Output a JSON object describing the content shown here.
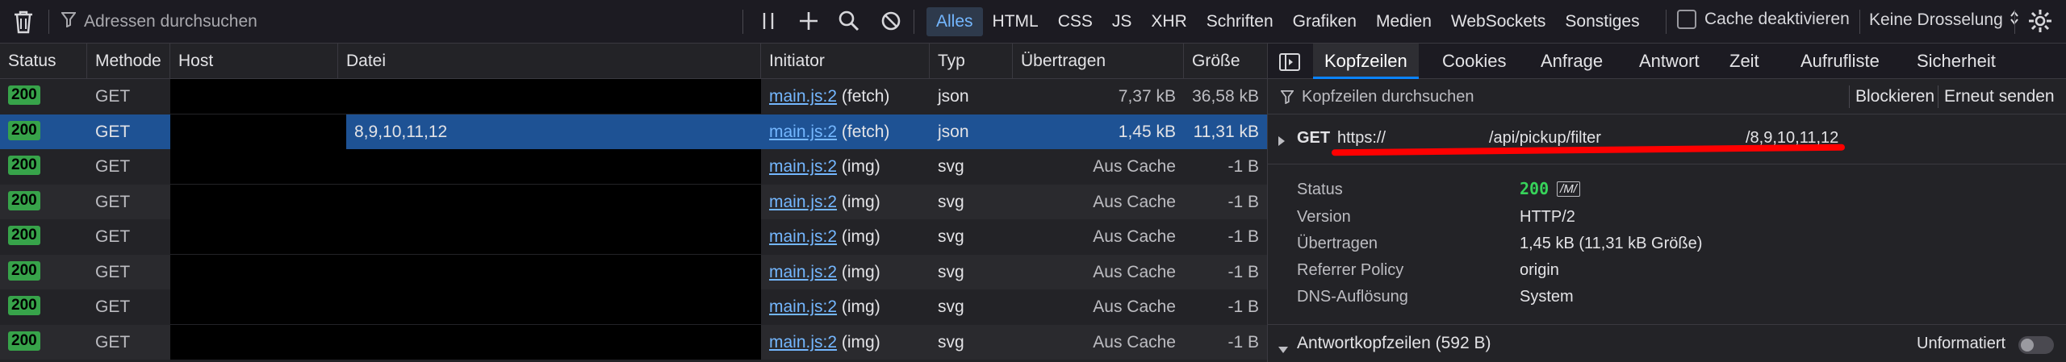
{
  "toolbar": {
    "filter_placeholder": "Adressen durchsuchen",
    "type_filters": [
      "Alles",
      "HTML",
      "CSS",
      "JS",
      "XHR",
      "Schriften",
      "Grafiken",
      "Medien",
      "WebSockets",
      "Sonstiges"
    ],
    "active_type": "Alles",
    "cache_label": "Cache deaktivieren",
    "throttle_label": "Keine Drosselung"
  },
  "table": {
    "headers": [
      "Status",
      "Methode",
      "Host",
      "Datei",
      "Initiator",
      "Typ",
      "Übertragen",
      "Größe"
    ],
    "rows": [
      {
        "status": "200",
        "method": "GET",
        "file": "",
        "initiator_link": "main.js:2",
        "initiator_kind": "(fetch)",
        "type": "json",
        "transferred": "7,37 kB",
        "size": "36,58 kB"
      },
      {
        "status": "200",
        "method": "GET",
        "file": "8,9,10,11,12",
        "initiator_link": "main.js:2",
        "initiator_kind": "(fetch)",
        "type": "json",
        "transferred": "1,45 kB",
        "size": "11,31 kB"
      },
      {
        "status": "200",
        "method": "GET",
        "file": "",
        "initiator_link": "main.js:2",
        "initiator_kind": "(img)",
        "type": "svg",
        "transferred": "Aus Cache",
        "size": "-1 B"
      },
      {
        "status": "200",
        "method": "GET",
        "file": "",
        "initiator_link": "main.js:2",
        "initiator_kind": "(img)",
        "type": "svg",
        "transferred": "Aus Cache",
        "size": "-1 B"
      },
      {
        "status": "200",
        "method": "GET",
        "file": "",
        "initiator_link": "main.js:2",
        "initiator_kind": "(img)",
        "type": "svg",
        "transferred": "Aus Cache",
        "size": "-1 B"
      },
      {
        "status": "200",
        "method": "GET",
        "file": "",
        "initiator_link": "main.js:2",
        "initiator_kind": "(img)",
        "type": "svg",
        "transferred": "Aus Cache",
        "size": "-1 B"
      },
      {
        "status": "200",
        "method": "GET",
        "file": "",
        "initiator_link": "main.js:2",
        "initiator_kind": "(img)",
        "type": "svg",
        "transferred": "Aus Cache",
        "size": "-1 B"
      },
      {
        "status": "200",
        "method": "GET",
        "file": "",
        "initiator_link": "main.js:2",
        "initiator_kind": "(img)",
        "type": "svg",
        "transferred": "Aus Cache",
        "size": "-1 B"
      }
    ]
  },
  "panel": {
    "tabs": [
      "Kopfzeilen",
      "Cookies",
      "Anfrage",
      "Antwort",
      "Zeit",
      "Aufrufliste",
      "Sicherheit"
    ],
    "active_tab": "Kopfzeilen",
    "filter_placeholder": "Kopfzeilen durchsuchen",
    "block_label": "Blockieren",
    "resend_label": "Erneut senden",
    "request": {
      "method": "GET",
      "url_part1": "https://",
      "url_part2": "/api/pickup/filter",
      "url_part3": "/8,9,10,11,12"
    },
    "details": [
      {
        "label": "Status",
        "value": "200"
      },
      {
        "label": "Version",
        "value": "HTTP/2"
      },
      {
        "label": "Übertragen",
        "value": "1,45 kB (11,31 kB Größe)"
      },
      {
        "label": "Referrer Policy",
        "value": "origin"
      },
      {
        "label": "DNS-Auflösung",
        "value": "System"
      }
    ],
    "status_code": "200",
    "status_icon_text": "/M/",
    "response_headers_label": "Antwortkopfzeilen (592 B)",
    "raw_label": "Unformatiert"
  },
  "colors": {
    "accent": "#0a84ff",
    "link": "#74b7ff",
    "status_ok": "#37a34a",
    "selected_row": "#1e5294",
    "annotation": "#ff0000"
  }
}
